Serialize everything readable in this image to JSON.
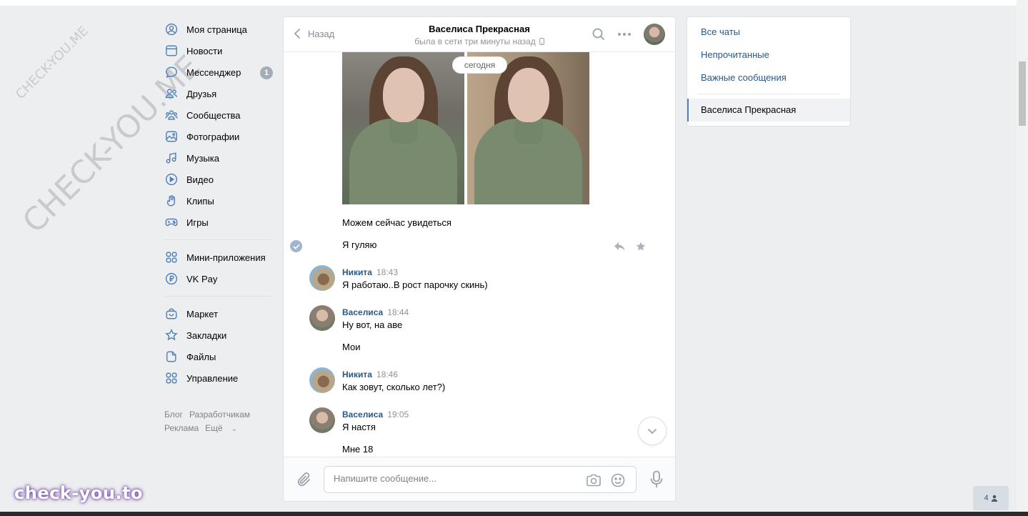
{
  "watermark": {
    "small": "CHECK-YOU.ME",
    "large": "CHECK-YOU.ME",
    "brand": "check-you.to"
  },
  "nav": {
    "items": [
      {
        "label": "Моя страница",
        "icon": "user-circle-icon"
      },
      {
        "label": "Новости",
        "icon": "news-icon"
      },
      {
        "label": "Мессенджер",
        "icon": "message-icon",
        "badge": "1"
      },
      {
        "label": "Друзья",
        "icon": "friends-icon"
      },
      {
        "label": "Сообщества",
        "icon": "communities-icon"
      },
      {
        "label": "Фотографии",
        "icon": "photos-icon"
      },
      {
        "label": "Музыка",
        "icon": "music-icon"
      },
      {
        "label": "Видео",
        "icon": "video-icon"
      },
      {
        "label": "Клипы",
        "icon": "clips-icon"
      },
      {
        "label": "Игры",
        "icon": "games-icon"
      }
    ],
    "items2": [
      {
        "label": "Мини-приложения",
        "icon": "apps-icon"
      },
      {
        "label": "VK Pay",
        "icon": "vkpay-icon"
      }
    ],
    "items3": [
      {
        "label": "Маркет",
        "icon": "market-icon"
      },
      {
        "label": "Закладки",
        "icon": "bookmark-icon"
      },
      {
        "label": "Файлы",
        "icon": "files-icon"
      },
      {
        "label": "Управление",
        "icon": "manage-icon"
      }
    ],
    "footer": {
      "blog": "Блог",
      "dev": "Разработчикам",
      "ads": "Реклама",
      "more": "Ещё"
    }
  },
  "chat": {
    "back_label": "Назад",
    "peer_name": "Васелиса Прекрасная",
    "peer_status": "была в сети три минуты назад",
    "date_pill": "сегодня",
    "messages": {
      "m1": "Можем сейчас увидеться",
      "m2": "Я гуляю",
      "g1": {
        "author": "Никита",
        "time": "18:43",
        "text": "Я работаю..В рост парочку скинь)"
      },
      "g2": {
        "author": "Васелиса",
        "time": "18:44",
        "text": "Ну вот, на аве",
        "text2": "Мои"
      },
      "g3": {
        "author": "Никита",
        "time": "18:46",
        "text": "Как зовут, сколько лет?)"
      },
      "g4": {
        "author": "Васелиса",
        "time": "19:05",
        "text": "Я настя",
        "text2": "Мне 18"
      }
    },
    "composer": {
      "placeholder": "Напишите сообщение..."
    }
  },
  "right": {
    "all": "Все чаты",
    "unread": "Непрочитанные",
    "important": "Важные сообщения",
    "active": "Васелиса Прекрасная"
  },
  "online_count": "4",
  "colors": {
    "link": "#2a5885",
    "accent": "#5181b8",
    "bg": "#edeef0"
  }
}
